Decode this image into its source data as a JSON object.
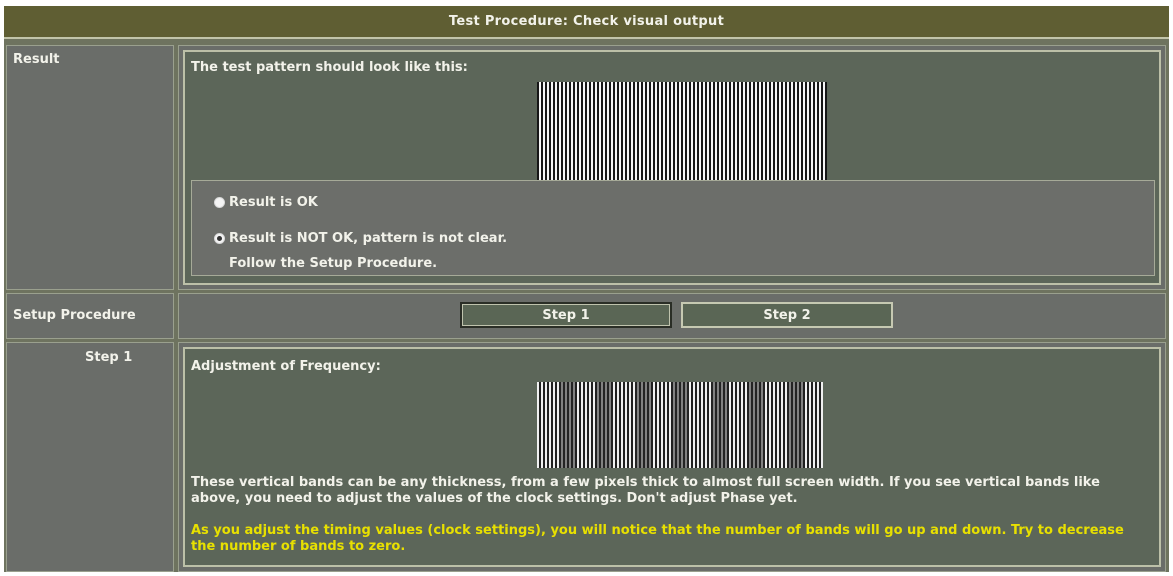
{
  "header": {
    "title": "Test Procedure: Check visual output"
  },
  "result": {
    "label": "Result",
    "intro": "The test pattern should look like this:",
    "options": [
      {
        "label": "Result is OK",
        "checked": false
      },
      {
        "label": "Result is NOT OK, pattern is not clear.",
        "checked": true
      }
    ],
    "follow_text": "Follow the Setup Procedure."
  },
  "setup": {
    "label": "Setup Procedure",
    "buttons": [
      {
        "label": "Step 1",
        "active": true
      },
      {
        "label": "Step 2",
        "active": false
      }
    ]
  },
  "step1": {
    "label": "Step 1",
    "title": "Adjustment of Frequency:",
    "description": "These vertical bands can be any thickness, from a few pixels thick to almost full screen width. If you see vertical bands like above, you need to adjust the values of the clock settings. Don't adjust Phase yet.",
    "note": "As you adjust the timing values (clock settings), you will notice that the number of bands will go up and down. Try to decrease the number of bands to zero."
  },
  "colors": {
    "header_bg": "#5f5e33",
    "panel_bg": "#5c6659",
    "note_text": "#e8e000"
  }
}
